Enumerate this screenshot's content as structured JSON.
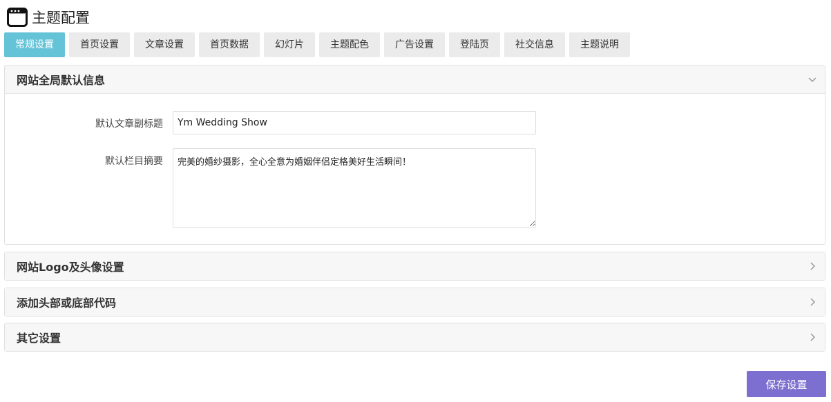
{
  "page": {
    "title": "主题配置",
    "icon": "window-icon"
  },
  "tabs": [
    {
      "label": "常规设置",
      "active": true
    },
    {
      "label": "首页设置",
      "active": false
    },
    {
      "label": "文章设置",
      "active": false
    },
    {
      "label": "首页数据",
      "active": false
    },
    {
      "label": "幻灯片",
      "active": false
    },
    {
      "label": "主题配色",
      "active": false
    },
    {
      "label": "广告设置",
      "active": false
    },
    {
      "label": "登陆页",
      "active": false
    },
    {
      "label": "社交信息",
      "active": false
    },
    {
      "label": "主题说明",
      "active": false
    }
  ],
  "sections": [
    {
      "title": "网站全局默认信息",
      "expanded": true,
      "chevron": "chevron-down-icon",
      "fields": {
        "subtitle_label": "默认文章副标题",
        "subtitle_value": "Ym Wedding Show",
        "summary_label": "默认栏目摘要",
        "summary_value": "完美的婚纱摄影，全心全意为婚姻伴侣定格美好生活瞬间！"
      }
    },
    {
      "title": "网站Logo及头像设置",
      "expanded": false,
      "chevron": "chevron-right-icon"
    },
    {
      "title": "添加头部或底部代码",
      "expanded": false,
      "chevron": "chevron-right-icon"
    },
    {
      "title": "其它设置",
      "expanded": false,
      "chevron": "chevron-right-icon"
    }
  ],
  "actions": {
    "save_label": "保存设置"
  },
  "colors": {
    "active_tab": "#65c3d8",
    "save_button": "#7c6fcf",
    "tab_bg": "#ebebeb"
  }
}
